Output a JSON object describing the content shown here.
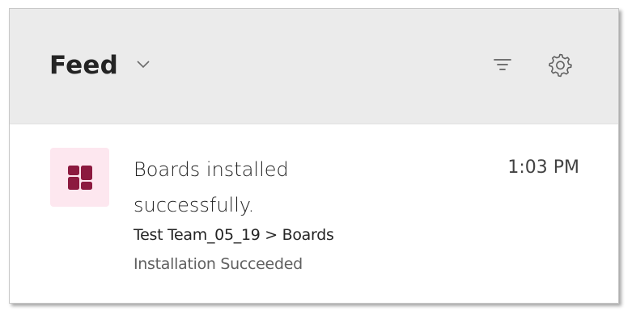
{
  "header": {
    "title": "Feed",
    "filter_icon": "filter-icon",
    "settings_icon": "gear-icon",
    "chevron_icon": "chevron-down-icon"
  },
  "feed": {
    "items": [
      {
        "app_icon": "boards-app-icon",
        "title": "Boards installed successfully.",
        "time": "1:03 PM",
        "path": "Test Team_05_19 > Boards",
        "status": "Installation Succeeded"
      }
    ]
  },
  "colors": {
    "header_background": "#ebebeb",
    "app_icon_background": "#fde7ef",
    "app_icon_foreground": "#8c1a3f",
    "text_primary": "#242424",
    "text_secondary": "#616161"
  }
}
